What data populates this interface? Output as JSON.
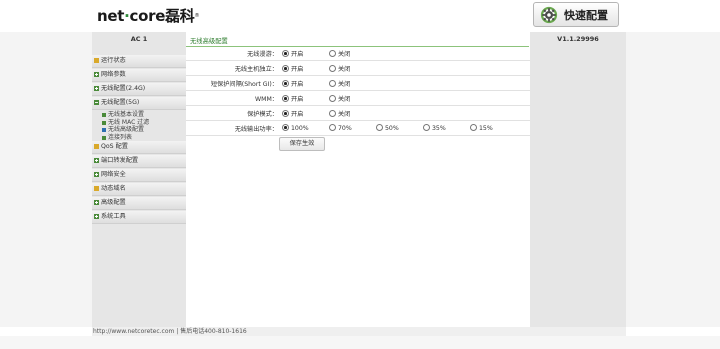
{
  "brand": {
    "logo_text_1": "net",
    "logo_dot": "·",
    "logo_text_2": "core",
    "logo_cn": "磊科",
    "logo_reg": "®"
  },
  "header": {
    "quick_config_label": "快速配置",
    "quick_icon": "gear-icon"
  },
  "left": {
    "title": "AC 1",
    "menu": [
      {
        "label": "运行状态",
        "icon": "dot-icon"
      },
      {
        "label": "网络参数",
        "icon": "expand-icon"
      },
      {
        "label": "无线配置(2.4G)",
        "icon": "expand-icon"
      },
      {
        "label": "无线配置(5G)",
        "icon": "collapse-icon"
      }
    ],
    "submenu": [
      {
        "label": "无线基本设置"
      },
      {
        "label": "无线 MAC 过滤"
      },
      {
        "label": "无线高级配置"
      },
      {
        "label": "连接列表"
      }
    ],
    "menu2": [
      {
        "label": "QoS 配置",
        "icon": "dot-icon"
      },
      {
        "label": "端口转发配置",
        "icon": "expand-icon"
      },
      {
        "label": "网络安全",
        "icon": "expand-icon"
      },
      {
        "label": "动态域名",
        "icon": "dot-icon"
      },
      {
        "label": "高级配置",
        "icon": "expand-icon"
      },
      {
        "label": "系统工具",
        "icon": "expand-icon"
      }
    ]
  },
  "right": {
    "version": "V1.1.29996"
  },
  "main": {
    "tab_label": "无线高级配置",
    "rows": [
      {
        "label": "无线漫游：",
        "options": [
          "开启",
          "关闭"
        ],
        "selected": 0
      },
      {
        "label": "无线主机独立：",
        "options": [
          "开启",
          "关闭"
        ],
        "selected": 0
      },
      {
        "label": "短保护间隔(Short GI)：",
        "options": [
          "开启",
          "关闭"
        ],
        "selected": 0
      },
      {
        "label": "WMM：",
        "options": [
          "开启",
          "关闭"
        ],
        "selected": 0
      },
      {
        "label": "保护模式：",
        "options": [
          "开启",
          "关闭"
        ],
        "selected": 0
      },
      {
        "label": "无线输出功率：",
        "options": [
          "100%",
          "70%",
          "50%",
          "35%",
          "15%"
        ],
        "selected": 0
      }
    ],
    "save_label": "保存生效"
  },
  "footer": {
    "text": "http://www.netcoretec.com | 售后电话400-810-1616"
  }
}
